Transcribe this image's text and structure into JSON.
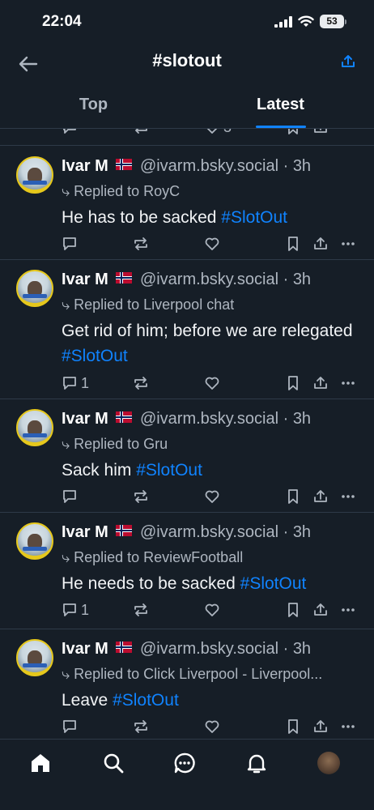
{
  "status_bar": {
    "time": "22:04",
    "battery": "53"
  },
  "header": {
    "title": "#slotout"
  },
  "tabs": [
    {
      "label": "Top"
    },
    {
      "label": "Latest"
    }
  ],
  "partial_post": {
    "likes": "3"
  },
  "posts": [
    {
      "author": "Ivar M",
      "handle": "@ivarm.bsky.social",
      "sep": "·",
      "time": "3h",
      "reply_to": "Replied to RoyC",
      "text": "He has to be sacked ",
      "hashtag": "#SlotOut",
      "replies": ""
    },
    {
      "author": "Ivar M",
      "handle": "@ivarm.bsky.social",
      "sep": "·",
      "time": "3h",
      "reply_to": "Replied to Liverpool chat",
      "text": "Get rid of him; before we are relegated ",
      "hashtag": "#SlotOut",
      "replies": "1"
    },
    {
      "author": "Ivar M",
      "handle": "@ivarm.bsky.social",
      "sep": "·",
      "time": "3h",
      "reply_to": "Replied to Gru",
      "text": "Sack him ",
      "hashtag": "#SlotOut",
      "replies": ""
    },
    {
      "author": "Ivar M",
      "handle": "@ivarm.bsky.social",
      "sep": "·",
      "time": "3h",
      "reply_to": "Replied to ReviewFootball",
      "text": "He needs to be sacked ",
      "hashtag": "#SlotOut",
      "replies": "1"
    },
    {
      "author": "Ivar M",
      "handle": "@ivarm.bsky.social",
      "sep": "·",
      "time": "3h",
      "reply_to": "Replied to Click Liverpool - Liverpool...",
      "text": "Leave ",
      "hashtag": "#SlotOut",
      "replies": ""
    }
  ],
  "icons": {
    "back": "arrow-left-icon",
    "share": "share-icon",
    "reply": "speech-bubble-icon",
    "repost": "repost-icon",
    "like": "heart-icon",
    "bookmark": "bookmark-icon",
    "more": "more-dots-icon"
  },
  "nav": [
    "home-icon",
    "search-icon",
    "chat-icon",
    "notifications-icon",
    "profile-avatar"
  ],
  "colors": {
    "accent": "#1083fe",
    "background": "#161e27",
    "muted": "#aeb6c0",
    "divider": "#2e3a48"
  }
}
